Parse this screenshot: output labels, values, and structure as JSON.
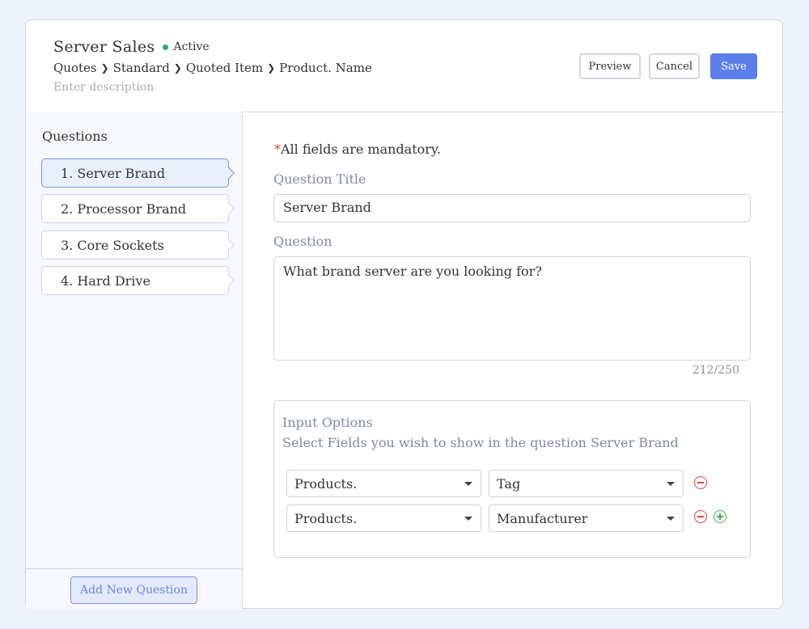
{
  "header": {
    "title": "Server Sales",
    "status": "Active",
    "breadcrumb": [
      "Quotes",
      "Standard",
      "Quoted Item",
      "Product. Name"
    ],
    "description_placeholder": "Enter description",
    "buttons": {
      "preview": "Preview",
      "cancel": "Cancel",
      "save": "Save"
    }
  },
  "sidebar": {
    "title": "Questions",
    "items": [
      {
        "label": "1. Server Brand",
        "active": true
      },
      {
        "label": "2. Processor Brand",
        "active": false
      },
      {
        "label": "3. Core Sockets",
        "active": false
      },
      {
        "label": "4. Hard Drive",
        "active": false
      }
    ],
    "add_button": "Add New Question"
  },
  "form": {
    "mandatory_star": "*",
    "mandatory_note": "All fields are mandatory.",
    "question_title_label": "Question Title",
    "question_title_value": "Server Brand",
    "question_label": "Question",
    "question_value": "What brand server are you looking for?",
    "char_count": "212/250",
    "input_options": {
      "title": "Input Options",
      "subtitle": "Select Fields you wish to show in the question Server Brand",
      "rows": [
        {
          "field": "Products.",
          "value": "Tag"
        },
        {
          "field": "Products.",
          "value": "Manufacturer"
        }
      ]
    }
  },
  "colors": {
    "accent": "#5b7fe8",
    "status_active": "#2bab6f",
    "remove": "#e0453a",
    "add": "#3fb04c"
  }
}
